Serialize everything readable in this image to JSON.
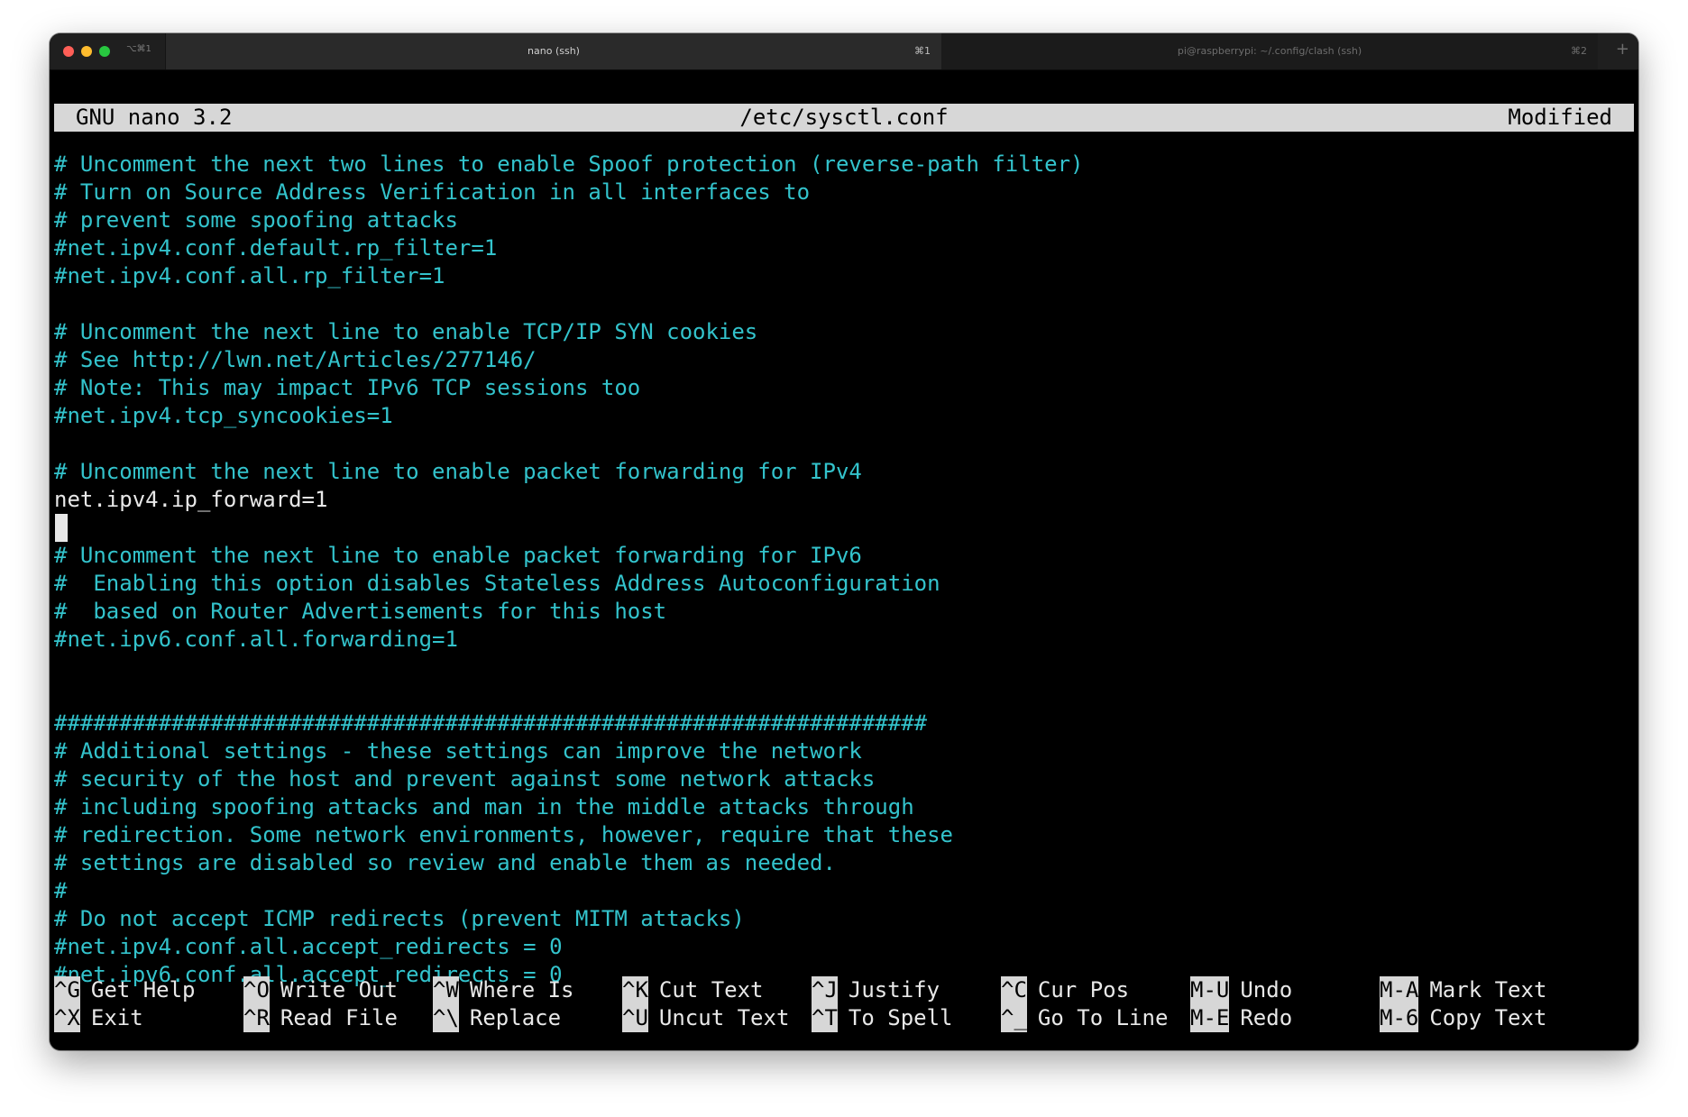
{
  "window": {
    "shortcut": "⌥⌘1",
    "tabs": [
      {
        "title": "nano (ssh)",
        "shortcut": "⌘1",
        "active": true
      },
      {
        "title": "pi@raspberrypi: ~/.config/clash (ssh)",
        "shortcut": "⌘2",
        "active": false
      }
    ],
    "new_tab_icon": "+"
  },
  "nano": {
    "version": "GNU nano 3.2",
    "filename": "/etc/sysctl.conf",
    "status": "Modified"
  },
  "colors": {
    "comment": "#33c3cc",
    "plain": "#e8e8e8",
    "header_bg": "#d7d7d7",
    "background": "#000000"
  },
  "lines": [
    {
      "text": "# Uncomment the next two lines to enable Spoof protection (reverse-path filter)",
      "kind": "comment"
    },
    {
      "text": "# Turn on Source Address Verification in all interfaces to",
      "kind": "comment"
    },
    {
      "text": "# prevent some spoofing attacks",
      "kind": "comment"
    },
    {
      "text": "#net.ipv4.conf.default.rp_filter=1",
      "kind": "comment"
    },
    {
      "text": "#net.ipv4.conf.all.rp_filter=1",
      "kind": "comment"
    },
    {
      "text": "",
      "kind": "plain"
    },
    {
      "text": "# Uncomment the next line to enable TCP/IP SYN cookies",
      "kind": "comment"
    },
    {
      "text": "# See http://lwn.net/Articles/277146/",
      "kind": "comment"
    },
    {
      "text": "# Note: This may impact IPv6 TCP sessions too",
      "kind": "comment"
    },
    {
      "text": "#net.ipv4.tcp_syncookies=1",
      "kind": "comment"
    },
    {
      "text": "",
      "kind": "plain"
    },
    {
      "text": "# Uncomment the next line to enable packet forwarding for IPv4",
      "kind": "comment"
    },
    {
      "text": "net.ipv4.ip_forward=1",
      "kind": "plain"
    },
    {
      "text": "",
      "kind": "cursor"
    },
    {
      "text": "# Uncomment the next line to enable packet forwarding for IPv6",
      "kind": "comment"
    },
    {
      "text": "#  Enabling this option disables Stateless Address Autoconfiguration",
      "kind": "comment"
    },
    {
      "text": "#  based on Router Advertisements for this host",
      "kind": "comment"
    },
    {
      "text": "#net.ipv6.conf.all.forwarding=1",
      "kind": "comment"
    },
    {
      "text": "",
      "kind": "plain"
    },
    {
      "text": "",
      "kind": "plain"
    },
    {
      "text": "###################################################################",
      "kind": "comment"
    },
    {
      "text": "# Additional settings - these settings can improve the network",
      "kind": "comment"
    },
    {
      "text": "# security of the host and prevent against some network attacks",
      "kind": "comment"
    },
    {
      "text": "# including spoofing attacks and man in the middle attacks through",
      "kind": "comment"
    },
    {
      "text": "# redirection. Some network environments, however, require that these",
      "kind": "comment"
    },
    {
      "text": "# settings are disabled so review and enable them as needed.",
      "kind": "comment"
    },
    {
      "text": "#",
      "kind": "comment"
    },
    {
      "text": "# Do not accept ICMP redirects (prevent MITM attacks)",
      "kind": "comment"
    },
    {
      "text": "#net.ipv4.conf.all.accept_redirects = 0",
      "kind": "comment"
    },
    {
      "text": "#net.ipv6.conf.all.accept_redirects = 0",
      "kind": "comment"
    }
  ],
  "shortcuts": [
    [
      {
        "key": "^G",
        "label": "Get Help"
      },
      {
        "key": "^O",
        "label": "Write Out"
      },
      {
        "key": "^W",
        "label": "Where Is"
      },
      {
        "key": "^K",
        "label": "Cut Text"
      },
      {
        "key": "^J",
        "label": "Justify"
      },
      {
        "key": "^C",
        "label": "Cur Pos"
      },
      {
        "key": "M-U",
        "label": "Undo"
      },
      {
        "key": "M-A",
        "label": "Mark Text"
      }
    ],
    [
      {
        "key": "^X",
        "label": "Exit"
      },
      {
        "key": "^R",
        "label": "Read File"
      },
      {
        "key": "^\\",
        "label": "Replace"
      },
      {
        "key": "^U",
        "label": "Uncut Text"
      },
      {
        "key": "^T",
        "label": "To Spell"
      },
      {
        "key": "^_",
        "label": "Go To Line"
      },
      {
        "key": "M-E",
        "label": "Redo"
      },
      {
        "key": "M-6",
        "label": "Copy Text"
      }
    ]
  ]
}
